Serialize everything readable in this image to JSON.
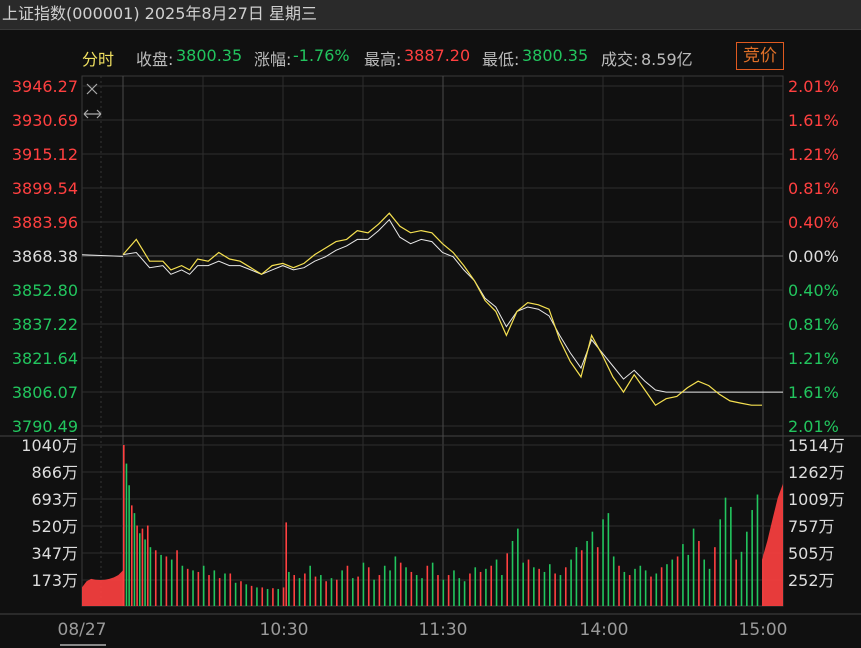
{
  "window_title": "上证指数(000001) 2025年8月27日 星期三",
  "info": {
    "mode_label": "分时",
    "close_label": "收盘:",
    "close_value": "3800.35",
    "change_label": "涨幅:",
    "change_value": "-1.76%",
    "high_label": "最高:",
    "high_value": "3887.20",
    "low_label": "最低:",
    "low_value": "3800.35",
    "volume_label": "成交:",
    "volume_value": "8.59亿",
    "auction_button": "竞价"
  },
  "colors": {
    "up": "#ff4040",
    "down": "#22c55e",
    "neutral": "#dddddd",
    "avg_line": "#f5e050",
    "price_line": "#e8e8e8",
    "accent": "#e07028"
  },
  "icons": {
    "close": "close-icon",
    "expand": "horizontal-arrows-icon"
  },
  "chart_data": [
    {
      "type": "line",
      "title": "",
      "ylim": [
        3790.49,
        3946.27
      ],
      "preclose": 3868.38,
      "price_ticks_left": [
        "3946.27",
        "3930.69",
        "3915.12",
        "3899.54",
        "3883.96",
        "3868.38",
        "3852.80",
        "3837.22",
        "3821.64",
        "3806.07",
        "3790.49"
      ],
      "pct_ticks_right": [
        "2.01%",
        "1.61%",
        "1.21%",
        "0.81%",
        "0.40%",
        "0.00%",
        "0.40%",
        "0.81%",
        "1.21%",
        "1.61%",
        "2.01%"
      ],
      "x_ticks": [
        "08/27",
        "10:30",
        "11:30",
        "14:00",
        "15:00"
      ],
      "series": [
        {
          "x": [
            0,
            5,
            10,
            15,
            18,
            22,
            25,
            28,
            32,
            36,
            40,
            44,
            48,
            52,
            56,
            60,
            64,
            68,
            72,
            76,
            80,
            84,
            88,
            92,
            96,
            100,
            104,
            108,
            112,
            116,
            120,
            124,
            128,
            132,
            136,
            140,
            144,
            148,
            152,
            156,
            160,
            164,
            168,
            172,
            176,
            180,
            184,
            188,
            192,
            196,
            200,
            204,
            208,
            212,
            216,
            220,
            224,
            228,
            232,
            236,
            240
          ],
          "y": [
            3869,
            3876,
            3866,
            3866,
            3862,
            3864,
            3862,
            3867,
            3866,
            3870,
            3867,
            3866,
            3863,
            3860,
            3864,
            3865,
            3863,
            3865,
            3869,
            3872,
            3875,
            3876,
            3880,
            3879,
            3883,
            3888,
            3882,
            3879,
            3880,
            3879,
            3874,
            3870,
            3864,
            3857,
            3848,
            3843,
            3832,
            3843,
            3847,
            3846,
            3844,
            3830,
            3820,
            3813,
            3832,
            3823,
            3813,
            3806,
            3814,
            3807,
            3800,
            3803,
            3804,
            3808,
            3811,
            3809,
            3805,
            3802,
            3801,
            3800,
            3800
          ]
        },
        {
          "x": [
            0,
            5,
            10,
            15,
            18,
            22,
            25,
            28,
            32,
            36,
            40,
            44,
            48,
            52,
            56,
            60,
            64,
            68,
            72,
            76,
            80,
            84,
            88,
            92,
            96,
            100,
            104,
            108,
            112,
            116,
            120,
            124,
            128,
            132,
            136,
            140,
            144,
            148,
            152,
            156,
            160,
            164,
            168,
            172,
            176,
            180,
            184,
            188,
            192,
            196,
            200,
            204,
            208,
            212,
            216,
            220,
            224,
            228,
            232,
            236,
            240
          ],
          "y": [
            3869,
            3870,
            3863,
            3864,
            3860,
            3862,
            3860,
            3864,
            3864,
            3866,
            3864,
            3864,
            3862,
            3860,
            3862,
            3864,
            3862,
            3863,
            3866,
            3868,
            3871,
            3873,
            3876,
            3876,
            3880,
            3885,
            3877,
            3874,
            3876,
            3875,
            3870,
            3868,
            3862,
            3857,
            3849,
            3845,
            3836,
            3843,
            3845,
            3844,
            3841,
            3832,
            3824,
            3817,
            3830,
            3824,
            3818,
            3812,
            3816,
            3811,
            3807,
            3806,
            3806,
            3806,
            3806,
            3806,
            3806,
            3806,
            3806,
            3806,
            3806
          ]
        }
      ]
    },
    {
      "type": "bar",
      "title": "",
      "left_ticks": [
        "1040万",
        "866万",
        "693万",
        "520万",
        "347万",
        "173万"
      ],
      "right_ticks": [
        "1514万",
        "1262万",
        "1009万",
        "757万",
        "505万",
        "252万"
      ],
      "ylim": [
        0,
        1040
      ],
      "auction_open_profile": [
        120,
        160,
        175,
        170,
        168,
        170,
        175,
        185,
        200,
        230
      ],
      "auction_close_profile": [
        300,
        420,
        560,
        700,
        790
      ],
      "bars": {
        "x": [
          0,
          1,
          2,
          3,
          4,
          5,
          6,
          7,
          8,
          9,
          10,
          12,
          14,
          16,
          18,
          20,
          22,
          24,
          26,
          28,
          30,
          32,
          34,
          36,
          38,
          40,
          42,
          44,
          46,
          48,
          50,
          52,
          54,
          56,
          58,
          60,
          61,
          62,
          64,
          66,
          68,
          70,
          72,
          74,
          76,
          78,
          80,
          82,
          84,
          86,
          88,
          90,
          92,
          94,
          96,
          98,
          100,
          102,
          104,
          106,
          108,
          110,
          112,
          114,
          116,
          118,
          120,
          122,
          124,
          126,
          128,
          130,
          132,
          134,
          136,
          138,
          140,
          142,
          144,
          146,
          148,
          150,
          152,
          154,
          156,
          158,
          160,
          162,
          164,
          166,
          168,
          170,
          172,
          174,
          176,
          178,
          180,
          182,
          184,
          186,
          188,
          190,
          192,
          194,
          196,
          198,
          200,
          202,
          204,
          206,
          208,
          210,
          212,
          214,
          216,
          218,
          220,
          222,
          224,
          226,
          228,
          230,
          232,
          234,
          236,
          238,
          239
        ],
        "values": [
          1040,
          920,
          780,
          650,
          600,
          520,
          470,
          500,
          430,
          520,
          380,
          360,
          330,
          320,
          300,
          360,
          260,
          240,
          230,
          220,
          260,
          200,
          230,
          180,
          210,
          210,
          150,
          160,
          140,
          130,
          120,
          120,
          110,
          115,
          110,
          120,
          540,
          220,
          200,
          180,
          210,
          260,
          190,
          200,
          160,
          180,
          170,
          230,
          260,
          180,
          190,
          280,
          250,
          170,
          200,
          260,
          230,
          320,
          280,
          250,
          220,
          200,
          180,
          260,
          280,
          200,
          170,
          200,
          230,
          180,
          160,
          210,
          250,
          220,
          240,
          260,
          300,
          200,
          340,
          420,
          500,
          280,
          300,
          250,
          240,
          220,
          270,
          210,
          200,
          250,
          300,
          380,
          360,
          420,
          480,
          380,
          560,
          600,
          320,
          260,
          220,
          200,
          240,
          260,
          230,
          190,
          210,
          250,
          270,
          300,
          320,
          400,
          330,
          500,
          420,
          300,
          240,
          380,
          560,
          700,
          640,
          300,
          350,
          480,
          620,
          720
        ],
        "colors": [
          "r",
          "g",
          "g",
          "r",
          "g",
          "r",
          "g",
          "r",
          "g",
          "r",
          "g",
          "r",
          "g",
          "r",
          "g",
          "r",
          "g",
          "r",
          "g",
          "r",
          "g",
          "r",
          "g",
          "r",
          "g",
          "r",
          "g",
          "r",
          "g",
          "r",
          "g",
          "r",
          "g",
          "r",
          "g",
          "r",
          "r",
          "g",
          "r",
          "g",
          "r",
          "g",
          "r",
          "g",
          "r",
          "g",
          "r",
          "g",
          "r",
          "g",
          "r",
          "g",
          "r",
          "g",
          "r",
          "g",
          "g",
          "g",
          "r",
          "g",
          "r",
          "g",
          "g",
          "r",
          "g",
          "r",
          "g",
          "r",
          "g",
          "g",
          "g",
          "r",
          "g",
          "r",
          "g",
          "r",
          "g",
          "g",
          "r",
          "g",
          "g",
          "g",
          "r",
          "g",
          "r",
          "g",
          "g",
          "r",
          "g",
          "r",
          "g",
          "g",
          "r",
          "g",
          "g",
          "r",
          "g",
          "g",
          "g",
          "r",
          "g",
          "r",
          "g",
          "g",
          "g",
          "r",
          "g",
          "r",
          "g",
          "g",
          "r",
          "g",
          "g",
          "g",
          "r",
          "g",
          "g",
          "r",
          "g",
          "g",
          "g",
          "r",
          "g",
          "g",
          "g",
          "g",
          "g"
        ]
      }
    }
  ]
}
